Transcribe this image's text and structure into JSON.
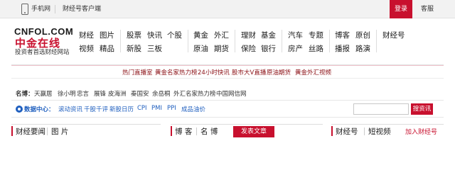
{
  "topbar": {
    "mobile_label": "手机网",
    "client_label": "财经号客户端",
    "login_label": "登录",
    "service_label": "客服"
  },
  "logo": {
    "top_text": "CNFOL.COM",
    "big_text": "中金在线",
    "tagline": "投资者首选财经网站"
  },
  "nav": {
    "group1": {
      "row1": [
        "财经",
        "图片"
      ],
      "row2": [
        "视频",
        "精品"
      ]
    },
    "group2": {
      "row1": [
        "股票",
        "快讯",
        "个股"
      ],
      "row2": [
        "新股",
        "三板"
      ]
    },
    "group3": {
      "row1": [
        "黄金",
        "外汇"
      ],
      "row2": [
        "原油",
        "期货"
      ]
    },
    "group4": {
      "row1": [
        "理财",
        "基金"
      ],
      "row2": [
        "保险",
        "银行"
      ]
    },
    "group5": {
      "row1": [
        "汽车",
        "专题"
      ],
      "row2": [
        "房产",
        "丝路"
      ]
    },
    "group6": {
      "row1": [
        "博客",
        "原创"
      ],
      "row2": [
        "播报",
        "路演"
      ]
    },
    "group7": {
      "row1": [
        "财经号"
      ]
    }
  },
  "hot_links": [
    "热门直播室",
    "黄金名家热力榜",
    "24小时快讯",
    "股市大V直播",
    "原油期货",
    "黄金外汇视频"
  ],
  "famous": {
    "label": "名博：",
    "items": [
      "天赢居",
      "徐小明",
      "忠言",
      "展锋",
      "皮海洲",
      "秦国安",
      "余岳桐",
      "外汇名家热力榜",
      "中国网信网"
    ]
  },
  "data_center": {
    "label": "数据中心：",
    "items": [
      "滚动资讯",
      "千股千评",
      "新股日历",
      "CPI",
      "PMI",
      "PPI",
      "成品油价"
    ],
    "search_placeholder": "",
    "search_button": "搜资讯"
  },
  "sections": {
    "left_tabs": [
      "财经要闻",
      "图 片"
    ],
    "middle_tabs": [
      "博 客",
      "名 博"
    ],
    "post_button": "发表文章",
    "right_tabs": [
      "财经号",
      "短视频"
    ],
    "add_button": "加入财经号"
  },
  "colors": {
    "brand_red": "#c8102e",
    "data_blue": "#1f5fbf",
    "hot_link": "#8b0f14"
  }
}
